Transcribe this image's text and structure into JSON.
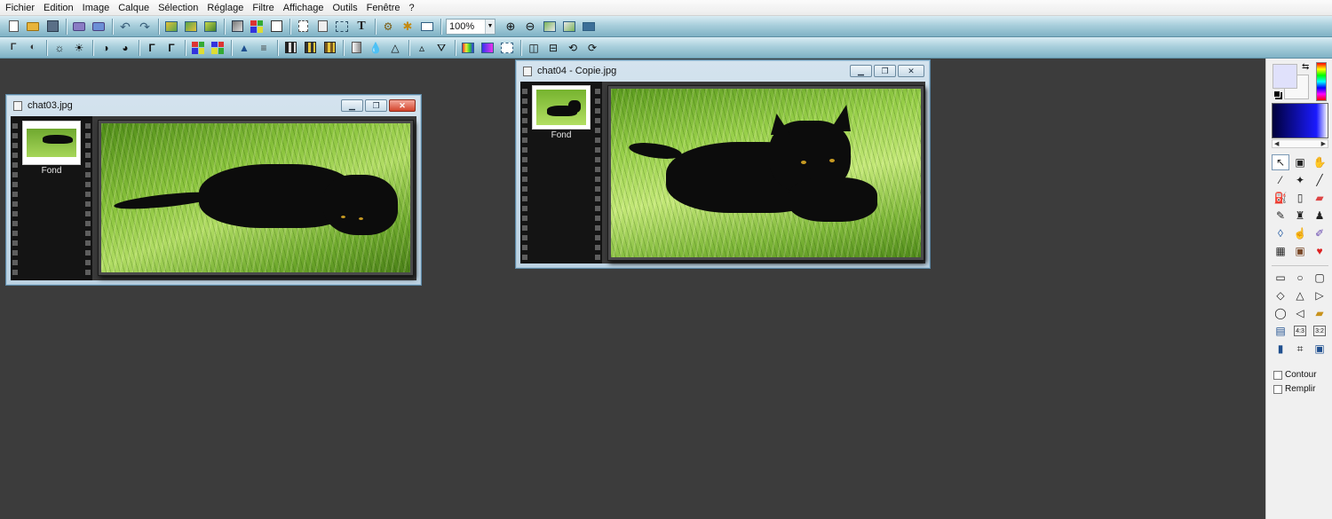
{
  "menu": {
    "items": [
      "Fichier",
      "Edition",
      "Image",
      "Calque",
      "Sélection",
      "Réglage",
      "Filtre",
      "Affichage",
      "Outils",
      "Fenêtre",
      "?"
    ]
  },
  "toolbar1": {
    "zoom_value": "100%",
    "buttons": [
      "new-icon",
      "open-icon",
      "save-icon",
      "print-icon",
      "scan-icon",
      "undo-icon",
      "redo-icon",
      "paste-new-icon",
      "paste-layer-icon",
      "paste-selection-icon",
      "fill-icon",
      "palette-icon",
      "layers-icon",
      "select-all-icon",
      "crop-icon",
      "text-icon",
      "plugin-icon",
      "effects-icon",
      "screen-icon",
      "zoom-in-icon",
      "zoom-out-icon",
      "fit-window-icon",
      "actual-size-icon",
      "fullscreen-icon"
    ]
  },
  "toolbar2": {
    "buttons": [
      "auto-levels-icon",
      "auto-contrast-icon",
      "brightness-down-icon",
      "brightness-up-icon",
      "contrast-down-icon",
      "contrast-up-icon",
      "gamma-down-icon",
      "gamma-up-icon",
      "color-down-icon",
      "color-up-icon",
      "histogram-icon",
      "equalize-icon",
      "filter-a-icon",
      "filter-b-icon",
      "filter-c-icon",
      "filter-d-icon",
      "blur-icon",
      "sharpen-icon",
      "drop-a-icon",
      "drop-b-icon",
      "color-balance-icon",
      "hue-icon",
      "negative-icon",
      "flip-horizontal-icon",
      "flip-vertical-icon",
      "rotate-left-icon",
      "rotate-right-icon"
    ]
  },
  "windows": [
    {
      "title": "chat03.jpg",
      "layer_label": "Fond",
      "active": true
    },
    {
      "title": "chat04 - Copie.jpg",
      "layer_label": "Fond",
      "active": false
    }
  ],
  "palette": {
    "foreground_color": "#e0e1fb",
    "background_color": "#f8f8f8",
    "contour_label": "Contour",
    "fill_label": "Remplir"
  },
  "tools": [
    "pointer-icon",
    "selection-window-icon",
    "hand-icon",
    "eyedropper-icon",
    "magic-wand-icon",
    "line-icon",
    "bucket-icon",
    "spray-icon",
    "eraser-icon",
    "brush-icon",
    "clone-icon",
    "stamp-icon",
    "drop-icon",
    "smudge-icon",
    "pencil-brush-icon",
    "texture-icon",
    "portrait-icon",
    "strawberry-icon"
  ],
  "shapes": [
    "rectangle-icon",
    "ellipse-icon",
    "rounded-rect-icon",
    "diamond-icon",
    "triangle-icon",
    "right-triangle-icon",
    "lasso-icon",
    "polygon-lasso-icon",
    "open-folder-icon",
    "ratio-free-icon",
    "ratio-4-3-icon",
    "ratio-3-2-icon",
    "ratio-portrait-icon",
    "transform-icon",
    "window-select-icon"
  ],
  "shape_labels": {
    "ratio43": "4:3",
    "ratio32": "3:2"
  }
}
